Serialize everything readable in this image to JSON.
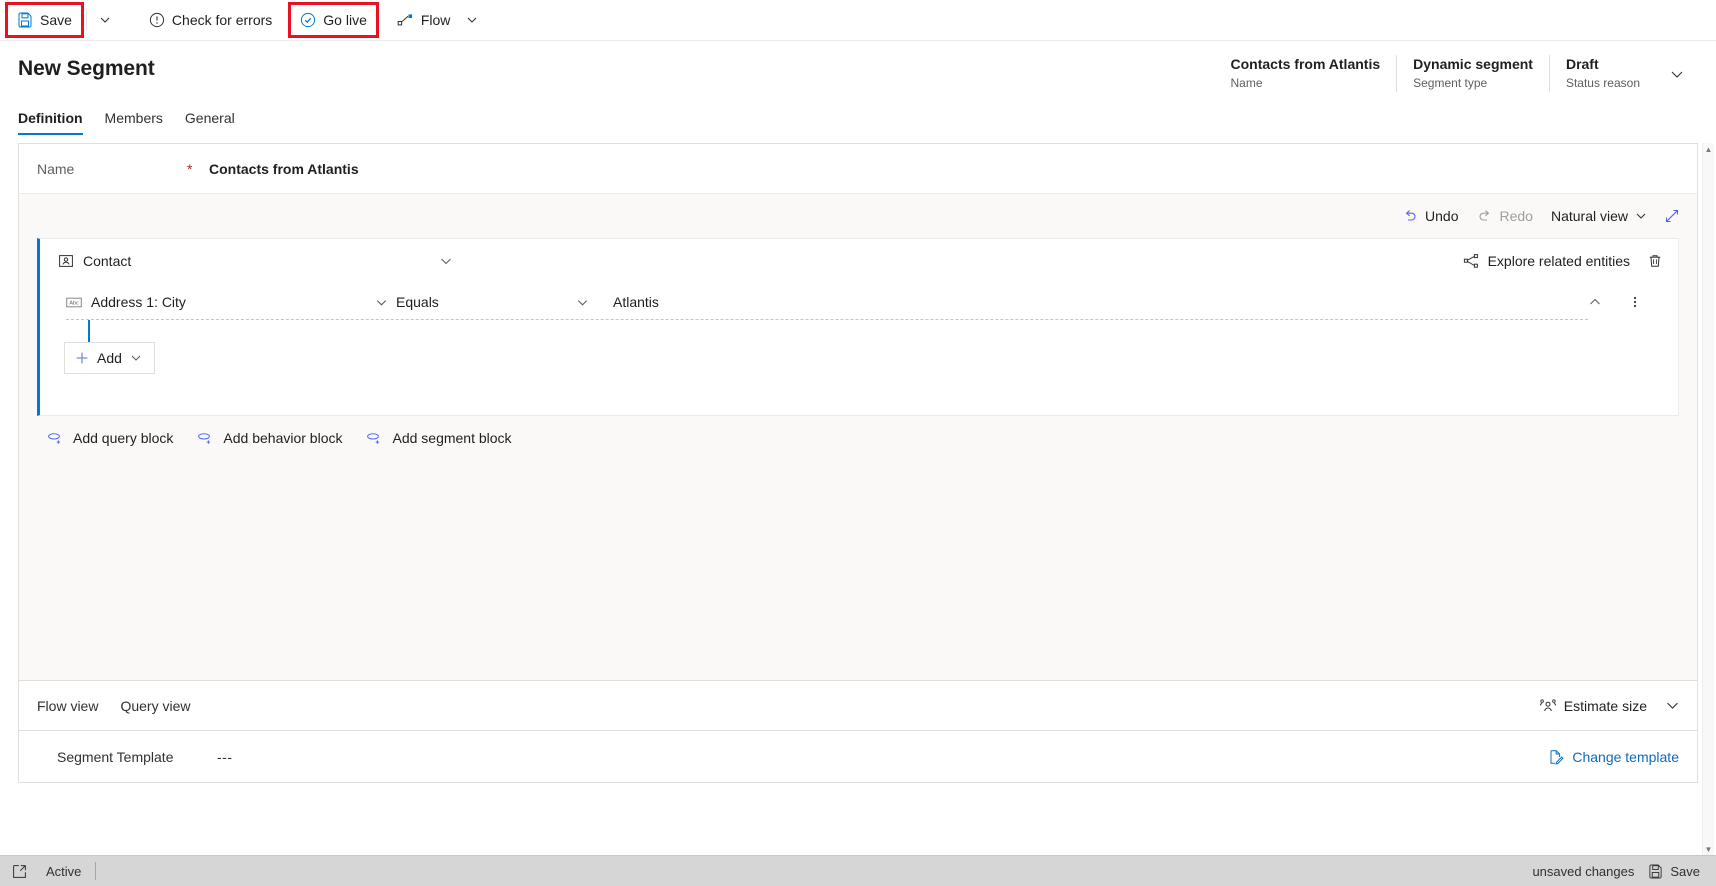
{
  "commandbar": {
    "save_label": "Save",
    "save_caret_icon": "chevron-down-icon",
    "check_errors_label": "Check for errors",
    "go_live_label": "Go live",
    "flow_label": "Flow",
    "flow_caret_icon": "chevron-down-icon",
    "highlight_color": "#e81123"
  },
  "header": {
    "title": "New Segment",
    "meta": [
      {
        "value": "Contacts from Atlantis",
        "label": "Name"
      },
      {
        "value": "Dynamic segment",
        "label": "Segment type"
      },
      {
        "value": "Draft",
        "label": "Status reason"
      }
    ],
    "expand_icon": "chevron-down-icon"
  },
  "tabs": [
    {
      "label": "Definition",
      "active": true
    },
    {
      "label": "Members",
      "active": false
    },
    {
      "label": "General",
      "active": false
    }
  ],
  "form": {
    "name_field": {
      "label": "Name",
      "required_marker": "*",
      "value": "Contacts from Atlantis"
    }
  },
  "designer_toolbar": {
    "undo_label": "Undo",
    "redo_label": "Redo",
    "view_mode_label": "Natural view",
    "view_mode_caret_icon": "chevron-down-icon",
    "expand_icon": "expand-diagonal-icon"
  },
  "query_block": {
    "entity_icon": "contact-entity-icon",
    "entity_label": "Contact",
    "collapse_icon": "chevron-down-icon",
    "explore_label": "Explore related entities",
    "explore_icon": "share-nodes-icon",
    "delete_icon": "trash-icon",
    "condition": {
      "attribute_icon": "text-field-icon",
      "attribute": "Address 1: City",
      "attribute_caret_icon": "chevron-down-icon",
      "operator": "Equals",
      "operator_caret_icon": "chevron-down-icon",
      "value": "Atlantis",
      "collapse_icon": "chevron-up-icon",
      "more_icon": "more-vertical-icon"
    },
    "add_button": {
      "label": "Add",
      "plus_icon": "plus-icon",
      "caret_icon": "chevron-down-icon"
    }
  },
  "block_links": [
    {
      "label": "Add query block",
      "icon": "add-query-block-icon"
    },
    {
      "label": "Add behavior block",
      "icon": "add-behavior-block-icon"
    },
    {
      "label": "Add segment block",
      "icon": "add-segment-block-icon"
    }
  ],
  "view_bar": {
    "tabs": [
      {
        "label": "Flow view"
      },
      {
        "label": "Query view"
      }
    ],
    "estimate_label": "Estimate size",
    "estimate_icon": "people-icon",
    "estimate_caret_icon": "chevron-down-icon"
  },
  "template_row": {
    "label": "Segment Template",
    "value": "---",
    "change_label": "Change template",
    "change_icon": "document-edit-icon"
  },
  "statusbar": {
    "expand_icon": "popout-icon",
    "state_label": "Active",
    "unsaved_label": "unsaved changes",
    "save_label": "Save",
    "save_icon": "save-icon"
  },
  "colors": {
    "accent": "#0078d4",
    "link": "#0f6cbd",
    "required": "#a4262c",
    "highlight": "#e81123",
    "canvas_bg": "#faf9f8",
    "statusbar_bg": "#d6d6d6"
  }
}
